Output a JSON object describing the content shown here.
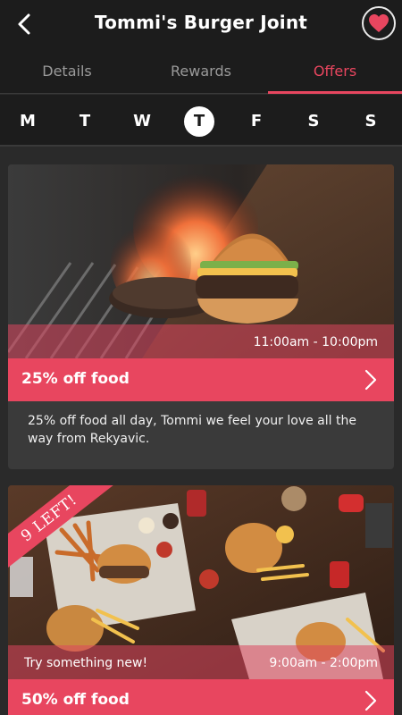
{
  "header": {
    "title": "Tommi's Burger Joint",
    "back_icon": "back-chevron-icon",
    "favorite_icon": "heart-icon"
  },
  "tabs": [
    {
      "label": "Details",
      "active": false
    },
    {
      "label": "Rewards",
      "active": false
    },
    {
      "label": "Offers",
      "active": true
    }
  ],
  "days": [
    {
      "label": "M",
      "active": false
    },
    {
      "label": "T",
      "active": false
    },
    {
      "label": "W",
      "active": false
    },
    {
      "label": "T",
      "active": true
    },
    {
      "label": "F",
      "active": false
    },
    {
      "label": "S",
      "active": false
    },
    {
      "label": "S",
      "active": false
    }
  ],
  "offers": [
    {
      "time": "11:00am - 10:00pm",
      "title": "25% off food",
      "description": "25% off food all day, Tommi we feel your love all the way from Rekyavic."
    },
    {
      "ribbon": "9 LEFT!",
      "tagline": "Try something new!",
      "time": "9:00am - 2:00pm",
      "title": "50% off food"
    }
  ],
  "colors": {
    "accent": "#e8465f",
    "header_bg": "#1c1c1c",
    "card_bg": "#3a3a3a"
  }
}
